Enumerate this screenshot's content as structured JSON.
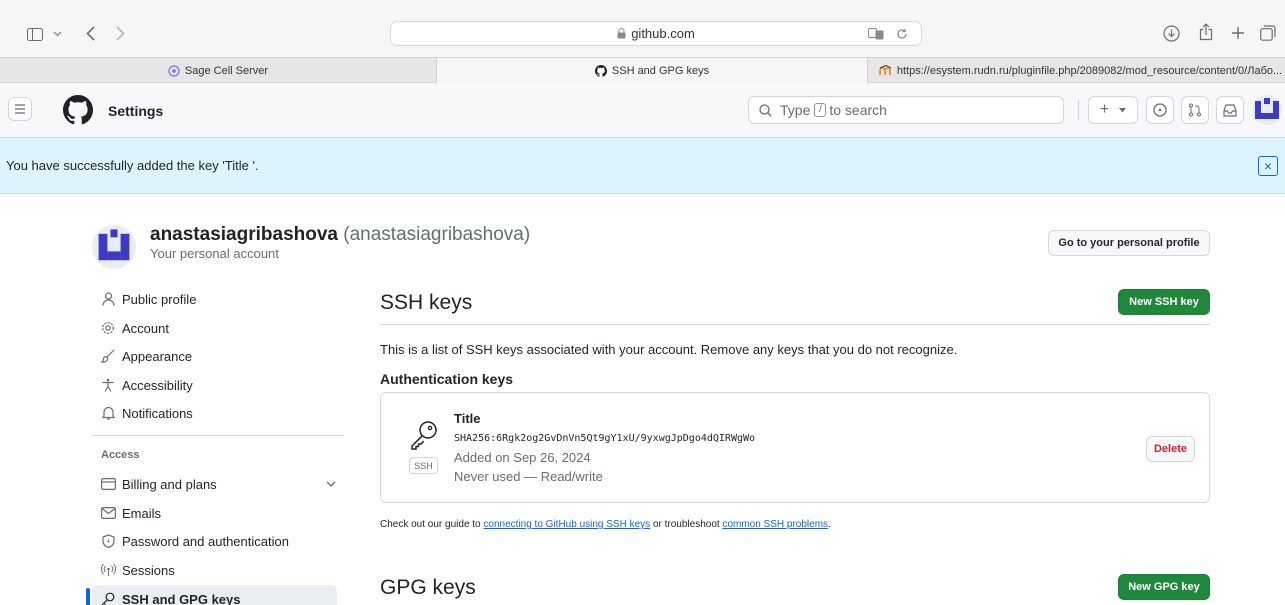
{
  "browser": {
    "url": "github.com",
    "tabs": [
      {
        "label": "Sage Cell Server"
      },
      {
        "label": "SSH and GPG keys"
      },
      {
        "label": "https://esystem.rudn.ru/pluginfile.php/2089082/mod_resource/content/0/Лабо..."
      }
    ]
  },
  "header": {
    "title": "Settings",
    "search_prefix": "Type",
    "search_key": "/",
    "search_suffix": "to search",
    "create_label": "+"
  },
  "flash": {
    "message": "You have successfully added the key 'Title '.",
    "close": "×"
  },
  "account": {
    "display_name": "anastasiagribashova",
    "login": "(anastasiagribashova)",
    "subtitle": "Your personal account",
    "profile_button": "Go to your personal profile"
  },
  "sidebar": {
    "items": [
      {
        "label": "Public profile",
        "icon": "person-icon"
      },
      {
        "label": "Account",
        "icon": "gear-icon"
      },
      {
        "label": "Appearance",
        "icon": "paintbrush-icon"
      },
      {
        "label": "Accessibility",
        "icon": "accessibility-icon"
      },
      {
        "label": "Notifications",
        "icon": "bell-icon"
      }
    ],
    "section_access": "Access",
    "access_items": [
      {
        "label": "Billing and plans",
        "icon": "credit-card-icon"
      },
      {
        "label": "Emails",
        "icon": "mail-icon"
      },
      {
        "label": "Password and authentication",
        "icon": "shield-lock-icon"
      },
      {
        "label": "Sessions",
        "icon": "broadcast-icon"
      },
      {
        "label": "SSH and GPG keys",
        "icon": "key-icon",
        "selected": true
      }
    ]
  },
  "ssh": {
    "title": "SSH keys",
    "new_button": "New SSH key",
    "description": "This is a list of SSH keys associated with your account. Remove any keys that you do not recognize.",
    "auth_heading": "Authentication keys",
    "key": {
      "title": "Title",
      "fingerprint": "SHA256:6Rgk2og2GvDnVn5Qt9gY1xU/9yxwgJpDgo4dQIRWgWo",
      "added": "Added on Sep 26, 2024",
      "usage": "Never used — Read/write",
      "badge": "SSH",
      "delete": "Delete"
    },
    "footer_prefix": "Check out our guide to",
    "footer_link1": "connecting to GitHub using SSH keys",
    "footer_middle": "or troubleshoot",
    "footer_link2": "common SSH problems",
    "footer_end": "."
  },
  "gpg": {
    "title": "GPG keys",
    "new_button": "New GPG key"
  },
  "colors": {
    "accent": "#0969da",
    "primary_button": "#1f883d",
    "danger": "#cf222e",
    "flash_bg": "#ddf4ff"
  }
}
